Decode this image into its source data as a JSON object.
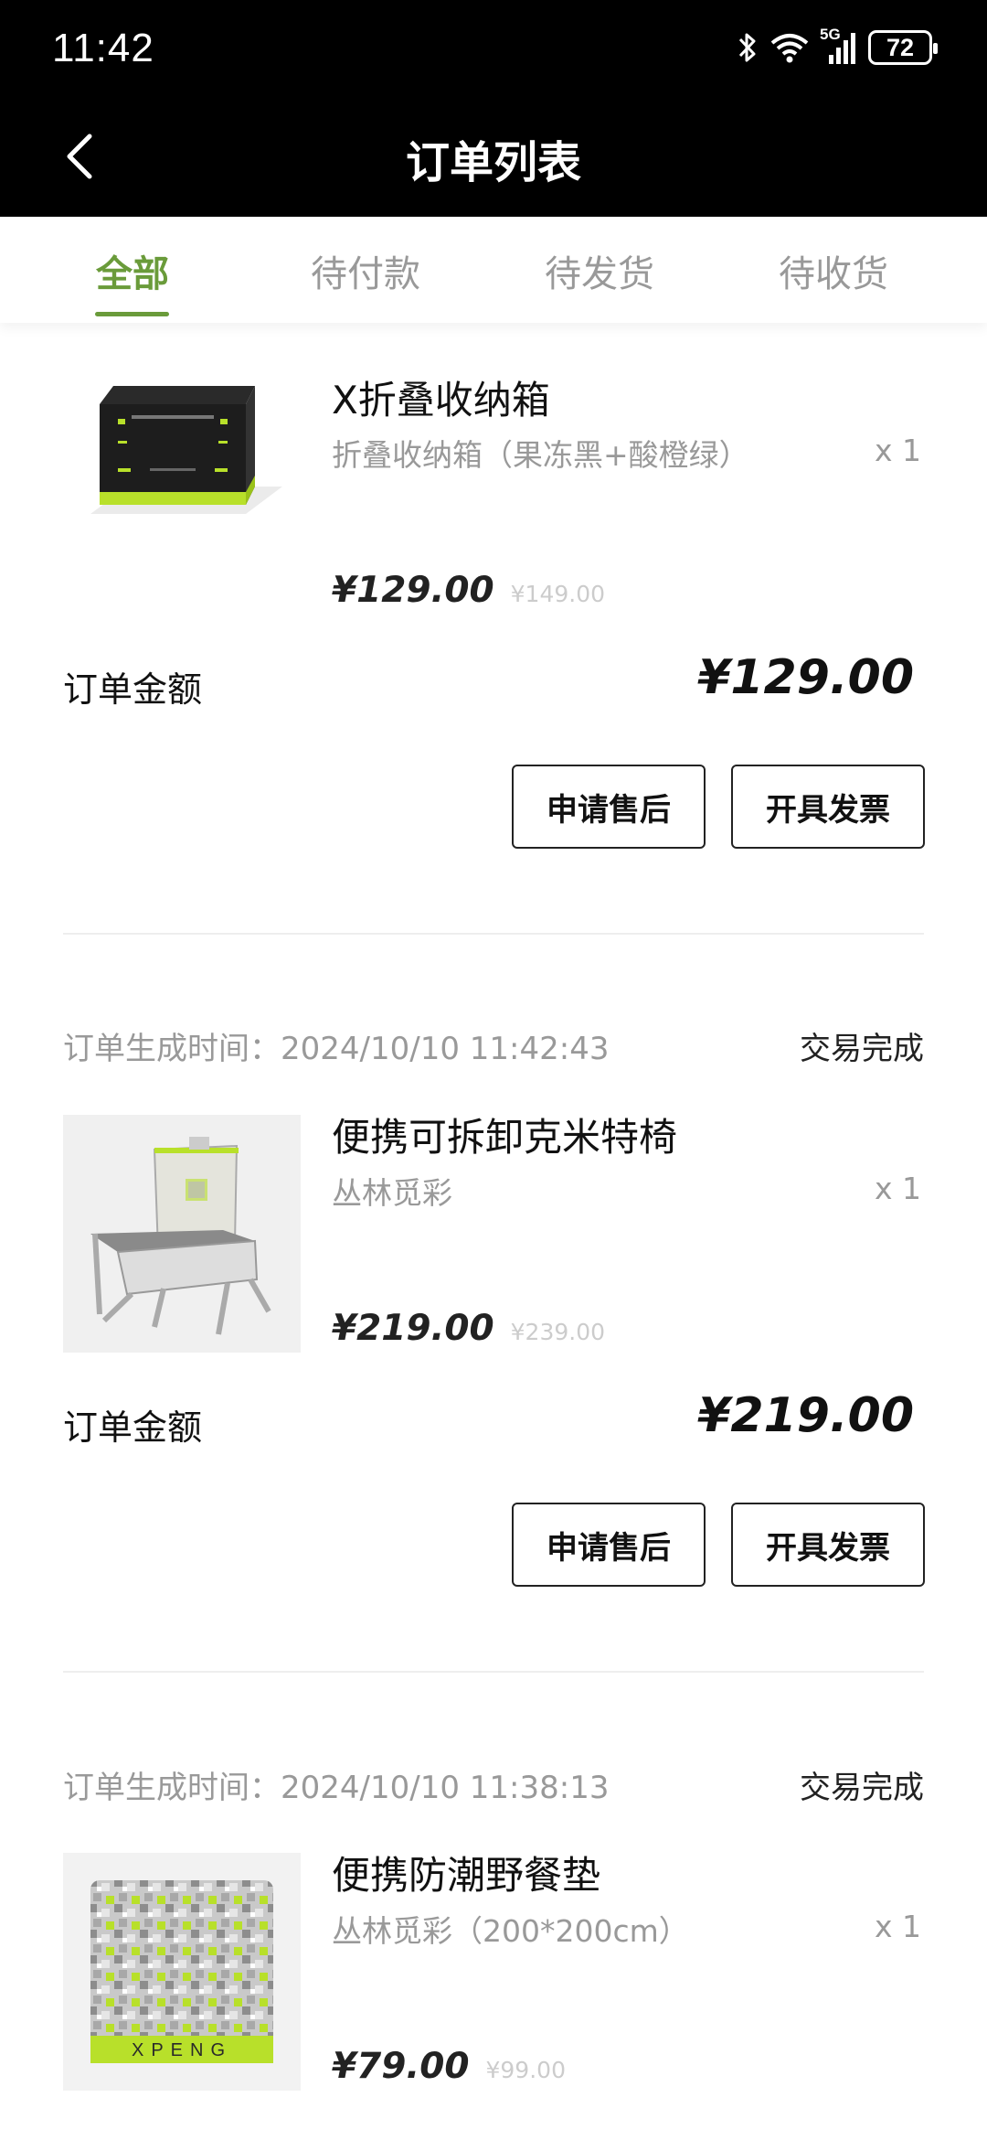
{
  "status_bar": {
    "time": "11:42",
    "battery": "72",
    "network": "5G"
  },
  "header": {
    "title": "订单列表"
  },
  "tabs": [
    {
      "label": "全部",
      "active": true
    },
    {
      "label": "待付款",
      "active": false
    },
    {
      "label": "待发货",
      "active": false
    },
    {
      "label": "待收货",
      "active": false
    }
  ],
  "orders": [
    {
      "product_name": "X折叠收纳箱",
      "spec": "折叠收纳箱（果冻黑+酸橙绿）",
      "qty": "x 1",
      "price": "¥129.00",
      "original_price": "¥149.00",
      "total_label": "订单金额",
      "total": "¥129.00",
      "buttons": {
        "after_sale": "申请售后",
        "invoice": "开具发票"
      }
    },
    {
      "time_label": "订单生成时间：",
      "time": "2024/10/10 11:42:43",
      "status": "交易完成",
      "product_name": "便携可拆卸克米特椅",
      "spec": "丛林觅彩",
      "qty": "x 1",
      "price": "¥219.00",
      "original_price": "¥239.00",
      "total_label": "订单金额",
      "total": "¥219.00",
      "buttons": {
        "after_sale": "申请售后",
        "invoice": "开具发票"
      }
    },
    {
      "time_label": "订单生成时间：",
      "time": "2024/10/10 11:38:13",
      "status": "交易完成",
      "product_name": "便携防潮野餐垫",
      "spec": "丛林觅彩（200*200cm）",
      "qty": "x 1",
      "price": "¥79.00",
      "original_price": "¥99.00",
      "mat_brand": "XPENG"
    }
  ],
  "colors": {
    "accent": "#6a9b3a",
    "lime": "#b8e02a"
  }
}
